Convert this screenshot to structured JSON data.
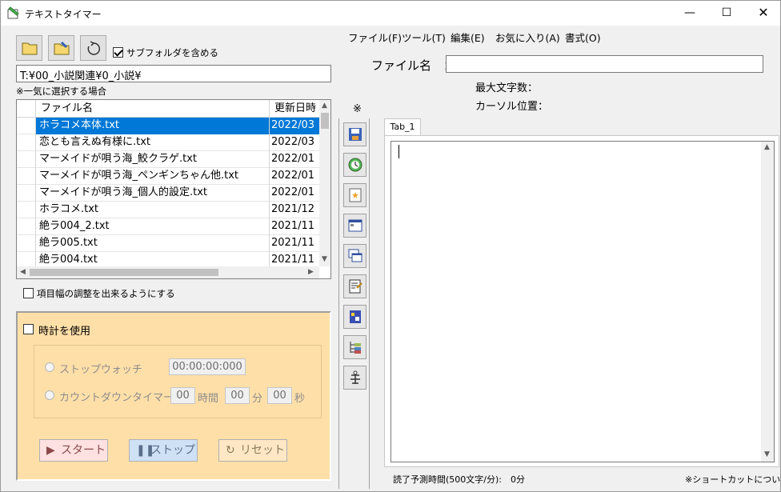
{
  "window": {
    "title": "テキストタイマー",
    "minimize": "—",
    "maximize": "☐",
    "close": "✕"
  },
  "toolbar": {
    "subfolder_label": "サブフォルダを含める",
    "subfolder_checked": true
  },
  "path": "T:¥00_小説関連¥0_小説¥",
  "bulk_note": "※一気に選択する場合",
  "file_list": {
    "headers": [
      "ファイル名",
      "更新日時"
    ],
    "rows": [
      {
        "name": "ホラコメ本体.txt",
        "date": "2022/03",
        "selected": true
      },
      {
        "name": "恋とも言えぬ有様に.txt",
        "date": "2022/03"
      },
      {
        "name": "マーメイドが唄う海_鮫クラゲ.txt",
        "date": "2022/01"
      },
      {
        "name": "マーメイドが唄う海_ペンギンちゃん他.txt",
        "date": "2022/01"
      },
      {
        "name": "マーメイドが唄う海_個人的設定.txt",
        "date": "2022/01"
      },
      {
        "name": "ホラコメ.txt",
        "date": "2021/12"
      },
      {
        "name": "絶ラ004_2.txt",
        "date": "2021/11"
      },
      {
        "name": "絶ラ005.txt",
        "date": "2021/11"
      },
      {
        "name": "絶ラ004.txt",
        "date": "2021/11"
      }
    ]
  },
  "column_resize_label": "項目幅の調整を出来るようにする",
  "timer": {
    "use_clock_label": "時計を使用",
    "stopwatch_label": "ストップウォッチ",
    "stopwatch_value": "00:00:00:000",
    "countdown_label": "カウントダウンタイマー",
    "hours_value": "00",
    "hours_unit": "時間",
    "minutes_value": "00",
    "minutes_unit": "分",
    "seconds_value": "00",
    "seconds_unit": "秒",
    "start_label": "スタート",
    "stop_label": "ストップ",
    "reset_label": "リセット"
  },
  "menu": [
    "ファイル(F)",
    "ツール(T)",
    "編集(E)",
    "お気に入り(A)",
    "書式(O)"
  ],
  "file_name": {
    "label": "ファイル名　：",
    "value": ""
  },
  "info": {
    "max_chars_label": "最大文字数：",
    "cursor_pos_label": "カーソル位置："
  },
  "side_note": "※",
  "side_tools": [
    "save-icon",
    "clock-icon",
    "new-icon",
    "window-icon",
    "windows-icon",
    "edit-icon",
    "doc-icon",
    "tree-icon",
    "pin-icon"
  ],
  "tab_label": "Tab_1",
  "editor_text": "",
  "status": {
    "estimate": "読了予測時間(500文字/分):　0分",
    "shortcut": "※ショートカットについて"
  },
  "colors": {
    "selection": "#0078d7",
    "timer_bg": "#ffdfa8",
    "start_bg": "#ffe1e1",
    "stop_bg": "#cfe1f5",
    "reset_bg": "#ffe7c6"
  }
}
